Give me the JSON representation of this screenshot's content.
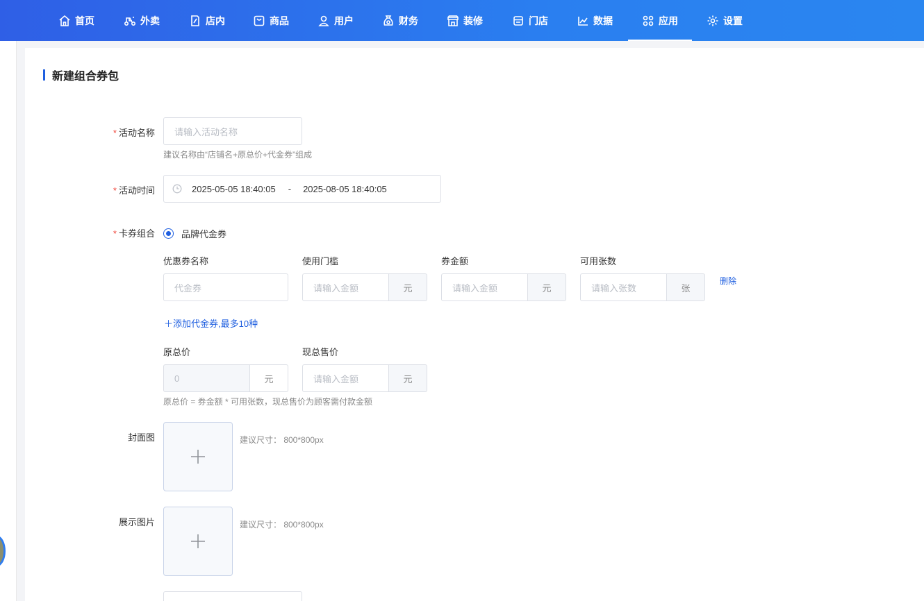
{
  "nav": {
    "items": [
      {
        "label": "首页",
        "icon": "home-icon"
      },
      {
        "label": "外卖",
        "icon": "scooter-icon"
      },
      {
        "label": "店内",
        "icon": "store-edit-icon"
      },
      {
        "label": "商品",
        "icon": "bag-icon"
      },
      {
        "label": "用户",
        "icon": "user-icon"
      },
      {
        "label": "财务",
        "icon": "money-bag-icon"
      },
      {
        "label": "装修",
        "icon": "shop-front-icon"
      },
      {
        "label": "门店",
        "icon": "store-icon"
      },
      {
        "label": "数据",
        "icon": "chart-icon"
      },
      {
        "label": "应用",
        "icon": "apps-icon"
      },
      {
        "label": "设置",
        "icon": "gear-icon"
      }
    ],
    "active": "应用"
  },
  "page": {
    "title": "新建组合券包"
  },
  "form": {
    "name": {
      "label": "活动名称",
      "placeholder": "请输入活动名称",
      "hint": "建议名称由“店铺名+原总价+代金券”组成"
    },
    "time": {
      "label": "活动时间",
      "start": "2025-05-05 18:40:05",
      "sep": "-",
      "end": "2025-08-05 18:40:05"
    },
    "combo": {
      "label": "卡券组合",
      "option": "品牌代金券"
    },
    "coupon_table": {
      "headers": [
        "优惠券名称",
        "使用门槛",
        "券金额",
        "可用张数"
      ],
      "row": {
        "name_placeholder": "代金券",
        "threshold_placeholder": "请输入金额",
        "threshold_unit": "元",
        "amount_placeholder": "请输入金额",
        "amount_unit": "元",
        "count_placeholder": "请输入张数",
        "count_unit": "张",
        "delete": "删除"
      },
      "add_link": "＋添加代金券,最多10种"
    },
    "price": {
      "original_label": "原总价",
      "original_value": "0",
      "original_unit": "元",
      "current_label": "现总售价",
      "current_placeholder": "请输入金额",
      "current_unit": "元",
      "hint": "原总价 = 券金额 * 可用张数，现总售价为顾客需付款金额"
    },
    "cover": {
      "label": "封面图",
      "hint": "建议尺寸： 800*800px"
    },
    "display": {
      "label": "展示图片",
      "hint": "建议尺寸： 800*800px"
    }
  },
  "colors": {
    "nav_start": "#2f5fe6",
    "nav_end": "#2a86f0",
    "primary": "#1f5fe0",
    "required": "#f0453a"
  }
}
